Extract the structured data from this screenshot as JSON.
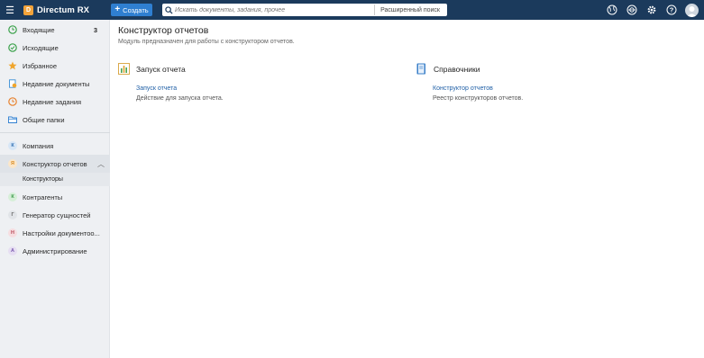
{
  "app": {
    "name": "Directum RX"
  },
  "topbar": {
    "create_label": "Создать",
    "search_placeholder": "Искать документы, задания, прочее",
    "advanced_search_label": "Расширенный поиск",
    "icons": [
      "globe-icon",
      "support-icon",
      "settings-icon",
      "help-icon",
      "avatar"
    ]
  },
  "sidebar": {
    "items": [
      {
        "label": "Входящие",
        "count": "3",
        "icon": "inbox-clock-icon"
      },
      {
        "label": "Исходящие",
        "icon": "outbox-check-icon"
      },
      {
        "label": "Избранное",
        "icon": "star-icon"
      },
      {
        "label": "Недавние документы",
        "icon": "recent-documents-icon"
      },
      {
        "label": "Недавние задания",
        "icon": "recent-tasks-icon"
      },
      {
        "label": "Общие папки",
        "icon": "shared-folders-icon"
      }
    ],
    "modules": [
      {
        "label": "Компания",
        "letter": "К"
      },
      {
        "label": "Конструктор отчетов",
        "letter": "Я",
        "sub": "Конструкторы"
      },
      {
        "label": "Контрагенты",
        "letter": "К"
      },
      {
        "label": "Генератор сущностей",
        "letter": "Г"
      },
      {
        "label": "Настройки документоо...",
        "letter": "Н"
      },
      {
        "label": "Администрирование",
        "letter": "А"
      }
    ]
  },
  "main": {
    "title": "Конструктор отчетов",
    "subtitle": "Модуль предназначен для работы с конструктором отчетов.",
    "sections": [
      {
        "title": "Запуск отчета",
        "link": "Запуск отчета",
        "desc": "Действие для запуска отчета.",
        "icon": "report-chart-icon"
      },
      {
        "title": "Справочники",
        "link": "Конструктор отчетов",
        "desc": "Реестр конструкторов отчетов.",
        "icon": "book-icon"
      }
    ]
  },
  "colors": {
    "topbar": "#1b3a5c",
    "accent": "#2f7fd1",
    "link": "#1f5fa6",
    "logo": "#f2a33a"
  }
}
